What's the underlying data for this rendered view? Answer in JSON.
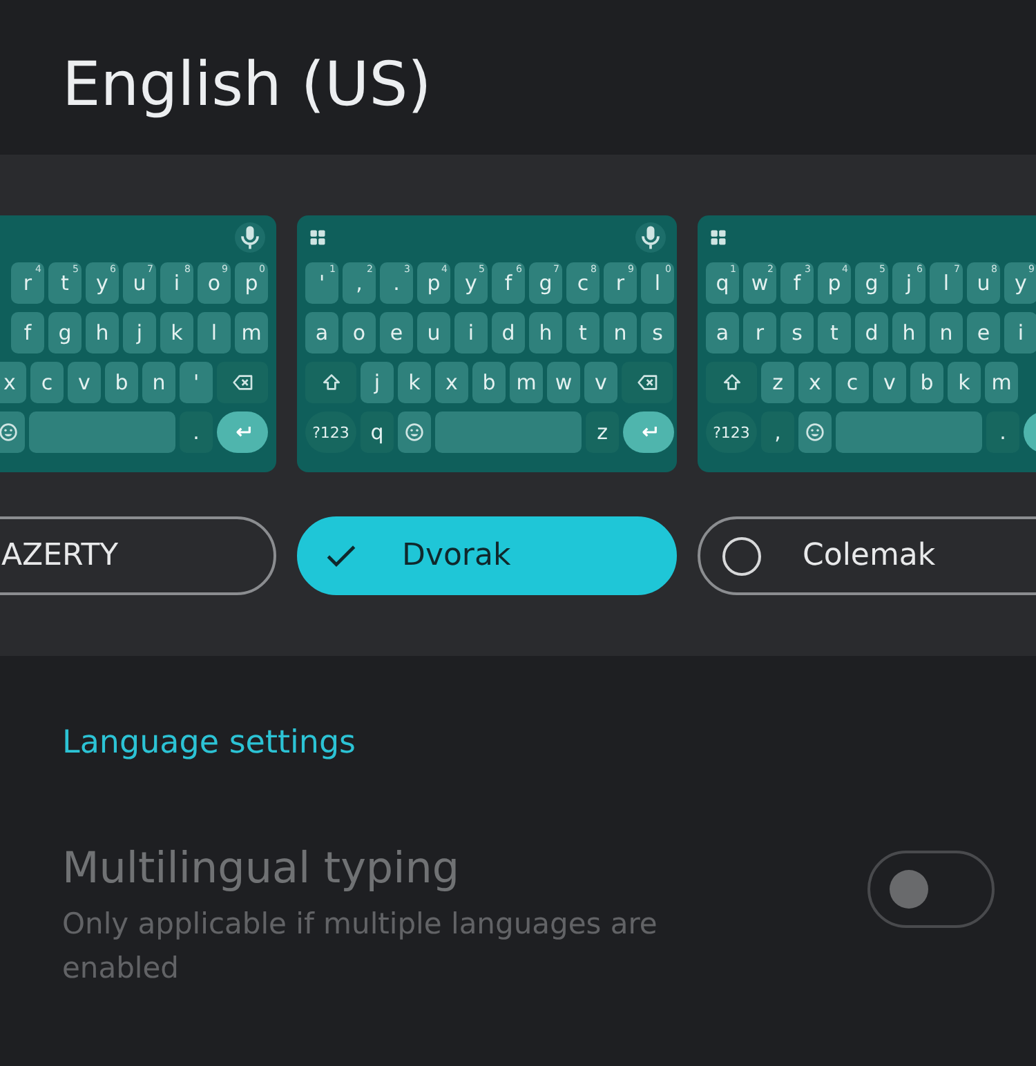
{
  "title": "English (US)",
  "layouts": [
    {
      "name": "AZERTY",
      "selected": false,
      "kind": "cutleft",
      "toolbar": [
        {
          "kind": "mic"
        }
      ],
      "rows": [
        [
          {
            "kind": "key",
            "label": "r",
            "hint": "4"
          },
          {
            "kind": "key",
            "label": "t",
            "hint": "5"
          },
          {
            "kind": "key",
            "label": "y",
            "hint": "6"
          },
          {
            "kind": "key",
            "label": "u",
            "hint": "7"
          },
          {
            "kind": "key",
            "label": "i",
            "hint": "8"
          },
          {
            "kind": "key",
            "label": "o",
            "hint": "9"
          },
          {
            "kind": "key",
            "label": "p",
            "hint": "0"
          }
        ],
        [
          {
            "kind": "key",
            "label": "f"
          },
          {
            "kind": "key",
            "label": "g"
          },
          {
            "kind": "key",
            "label": "h"
          },
          {
            "kind": "key",
            "label": "j"
          },
          {
            "kind": "key",
            "label": "k"
          },
          {
            "kind": "key",
            "label": "l"
          },
          {
            "kind": "key",
            "label": "m"
          }
        ],
        [
          {
            "kind": "key",
            "label": "x"
          },
          {
            "kind": "key",
            "label": "c"
          },
          {
            "kind": "key",
            "label": "v"
          },
          {
            "kind": "key",
            "label": "b"
          },
          {
            "kind": "key",
            "label": "n"
          },
          {
            "kind": "key",
            "label": "'"
          },
          {
            "kind": "backspace"
          }
        ],
        [
          {
            "kind": "emoji"
          },
          {
            "kind": "space"
          },
          {
            "kind": "fn",
            "label": "."
          },
          {
            "kind": "enter"
          }
        ]
      ]
    },
    {
      "name": "Dvorak",
      "selected": true,
      "kind": "whole",
      "toolbar": [
        {
          "kind": "grid"
        },
        {
          "kind": "mic"
        }
      ],
      "rows": [
        [
          {
            "kind": "key",
            "label": "'",
            "hint": "1"
          },
          {
            "kind": "key",
            "label": ",",
            "hint": "2"
          },
          {
            "kind": "key",
            "label": ".",
            "hint": "3"
          },
          {
            "kind": "key",
            "label": "p",
            "hint": "4"
          },
          {
            "kind": "key",
            "label": "y",
            "hint": "5"
          },
          {
            "kind": "key",
            "label": "f",
            "hint": "6"
          },
          {
            "kind": "key",
            "label": "g",
            "hint": "7"
          },
          {
            "kind": "key",
            "label": "c",
            "hint": "8"
          },
          {
            "kind": "key",
            "label": "r",
            "hint": "9"
          },
          {
            "kind": "key",
            "label": "l",
            "hint": "0"
          }
        ],
        [
          {
            "kind": "key",
            "label": "a"
          },
          {
            "kind": "key",
            "label": "o"
          },
          {
            "kind": "key",
            "label": "e"
          },
          {
            "kind": "key",
            "label": "u"
          },
          {
            "kind": "key",
            "label": "i"
          },
          {
            "kind": "key",
            "label": "d"
          },
          {
            "kind": "key",
            "label": "h"
          },
          {
            "kind": "key",
            "label": "t"
          },
          {
            "kind": "key",
            "label": "n"
          },
          {
            "kind": "key",
            "label": "s"
          }
        ],
        [
          {
            "kind": "shift"
          },
          {
            "kind": "key",
            "label": "j"
          },
          {
            "kind": "key",
            "label": "k"
          },
          {
            "kind": "key",
            "label": "x"
          },
          {
            "kind": "key",
            "label": "b"
          },
          {
            "kind": "key",
            "label": "m"
          },
          {
            "kind": "key",
            "label": "w"
          },
          {
            "kind": "key",
            "label": "v"
          },
          {
            "kind": "backspace"
          }
        ],
        [
          {
            "kind": "symbols",
            "label": "?123"
          },
          {
            "kind": "fn",
            "label": "q"
          },
          {
            "kind": "emoji"
          },
          {
            "kind": "space"
          },
          {
            "kind": "fn",
            "label": "z"
          },
          {
            "kind": "enter"
          }
        ]
      ]
    },
    {
      "name": "Colemak",
      "selected": false,
      "kind": "whole",
      "toolbar": [
        {
          "kind": "grid"
        }
      ],
      "rows": [
        [
          {
            "kind": "key",
            "label": "q",
            "hint": "1"
          },
          {
            "kind": "key",
            "label": "w",
            "hint": "2"
          },
          {
            "kind": "key",
            "label": "f",
            "hint": "3"
          },
          {
            "kind": "key",
            "label": "p",
            "hint": "4"
          },
          {
            "kind": "key",
            "label": "g",
            "hint": "5"
          },
          {
            "kind": "key",
            "label": "j",
            "hint": "6"
          },
          {
            "kind": "key",
            "label": "l",
            "hint": "7"
          },
          {
            "kind": "key",
            "label": "u",
            "hint": "8"
          },
          {
            "kind": "key",
            "label": "y",
            "hint": "9"
          }
        ],
        [
          {
            "kind": "key",
            "label": "a"
          },
          {
            "kind": "key",
            "label": "r"
          },
          {
            "kind": "key",
            "label": "s"
          },
          {
            "kind": "key",
            "label": "t"
          },
          {
            "kind": "key",
            "label": "d"
          },
          {
            "kind": "key",
            "label": "h"
          },
          {
            "kind": "key",
            "label": "n"
          },
          {
            "kind": "key",
            "label": "e"
          },
          {
            "kind": "key",
            "label": "i"
          }
        ],
        [
          {
            "kind": "shift"
          },
          {
            "kind": "key",
            "label": "z"
          },
          {
            "kind": "key",
            "label": "x"
          },
          {
            "kind": "key",
            "label": "c"
          },
          {
            "kind": "key",
            "label": "v"
          },
          {
            "kind": "key",
            "label": "b"
          },
          {
            "kind": "key",
            "label": "k"
          },
          {
            "kind": "key",
            "label": "m"
          }
        ],
        [
          {
            "kind": "symbols",
            "label": "?123"
          },
          {
            "kind": "fn",
            "label": ","
          },
          {
            "kind": "emoji"
          },
          {
            "kind": "space"
          },
          {
            "kind": "fn",
            "label": "."
          },
          {
            "kind": "enter"
          }
        ]
      ]
    }
  ],
  "language_settings_link": "Language settings",
  "multilingual": {
    "title": "Multilingual typing",
    "subtitle": "Only applicable if multiple languages are enabled",
    "on": false,
    "disabled": true
  }
}
